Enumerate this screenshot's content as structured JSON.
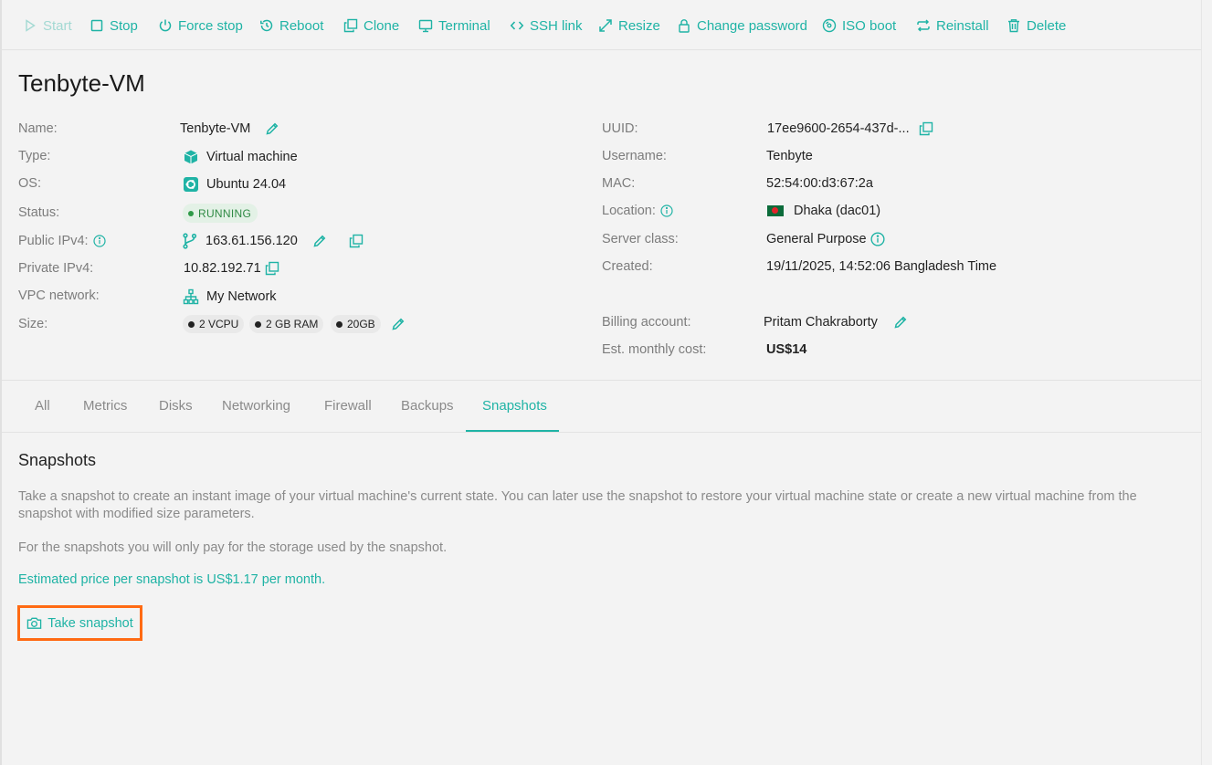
{
  "toolbar": {
    "start": "Start",
    "stop": "Stop",
    "force_stop": "Force stop",
    "reboot": "Reboot",
    "clone": "Clone",
    "terminal": "Terminal",
    "ssh_link": "SSH link",
    "resize": "Resize",
    "change_password": "Change password",
    "iso_boot": "ISO boot",
    "reinstall": "Reinstall",
    "delete": "Delete"
  },
  "page_title": "Tenbyte-VM",
  "details_left": {
    "name_label": "Name:",
    "name_value": "Tenbyte-VM",
    "type_label": "Type:",
    "type_value": "Virtual machine",
    "os_label": "OS:",
    "os_value": "Ubuntu 24.04",
    "status_label": "Status:",
    "status_value": "RUNNING",
    "public_ipv4_label": "Public IPv4:",
    "public_ipv4_value": "163.61.156.120",
    "private_ipv4_label": "Private IPv4:",
    "private_ipv4_value": "10.82.192.71",
    "vpc_label": "VPC network:",
    "vpc_value": "My Network",
    "size_label": "Size:",
    "size_chips": [
      "2 VCPU",
      "2 GB RAM",
      "20GB"
    ]
  },
  "details_right": {
    "uuid_label": "UUID:",
    "uuid_value": "17ee9600-2654-437d-...",
    "username_label": "Username:",
    "username_value": "Tenbyte",
    "mac_label": "MAC:",
    "mac_value": "52:54:00:d3:67:2a",
    "location_label": "Location:",
    "location_value": "Dhaka (dac01)",
    "server_class_label": "Server class:",
    "server_class_value": "General Purpose",
    "created_label": "Created:",
    "created_value": "19/11/2025, 14:52:06 Bangladesh Time",
    "billing_label": "Billing account:",
    "billing_value": "Pritam Chakraborty",
    "cost_label": "Est. monthly cost:",
    "cost_value": "US$14"
  },
  "tabs": [
    "All",
    "Metrics",
    "Disks",
    "Networking",
    "Firewall",
    "Backups",
    "Snapshots"
  ],
  "active_tab": "Snapshots",
  "snapshots": {
    "title": "Snapshots",
    "description_line1": "Take a snapshot to create an instant image of your virtual machine's current state. You can later use the snapshot to restore your virtual machine state or create a new virtual machine from the",
    "description_line2": "snapshot with modified size parameters.",
    "storage_note": "For the snapshots you will only pay for the storage used by the snapshot.",
    "price_note": "Estimated price per snapshot is US$1.17 per month.",
    "button_label": "Take snapshot"
  },
  "colors": {
    "accent": "#1fb3a5",
    "highlight_border": "#ff6a13",
    "status_green": "#2f8a44"
  },
  "icons": {
    "start": "play-icon",
    "stop": "square-stop-icon",
    "force_stop": "power-icon",
    "reboot": "history-icon",
    "clone": "copy-icon",
    "terminal": "monitor-icon",
    "ssh_link": "code-icon",
    "resize": "expand-arrows-icon",
    "change_password": "lock-icon",
    "iso_boot": "disc-icon",
    "reinstall": "repeat-icon",
    "delete": "trash-icon",
    "snapshot": "camera-icon"
  }
}
